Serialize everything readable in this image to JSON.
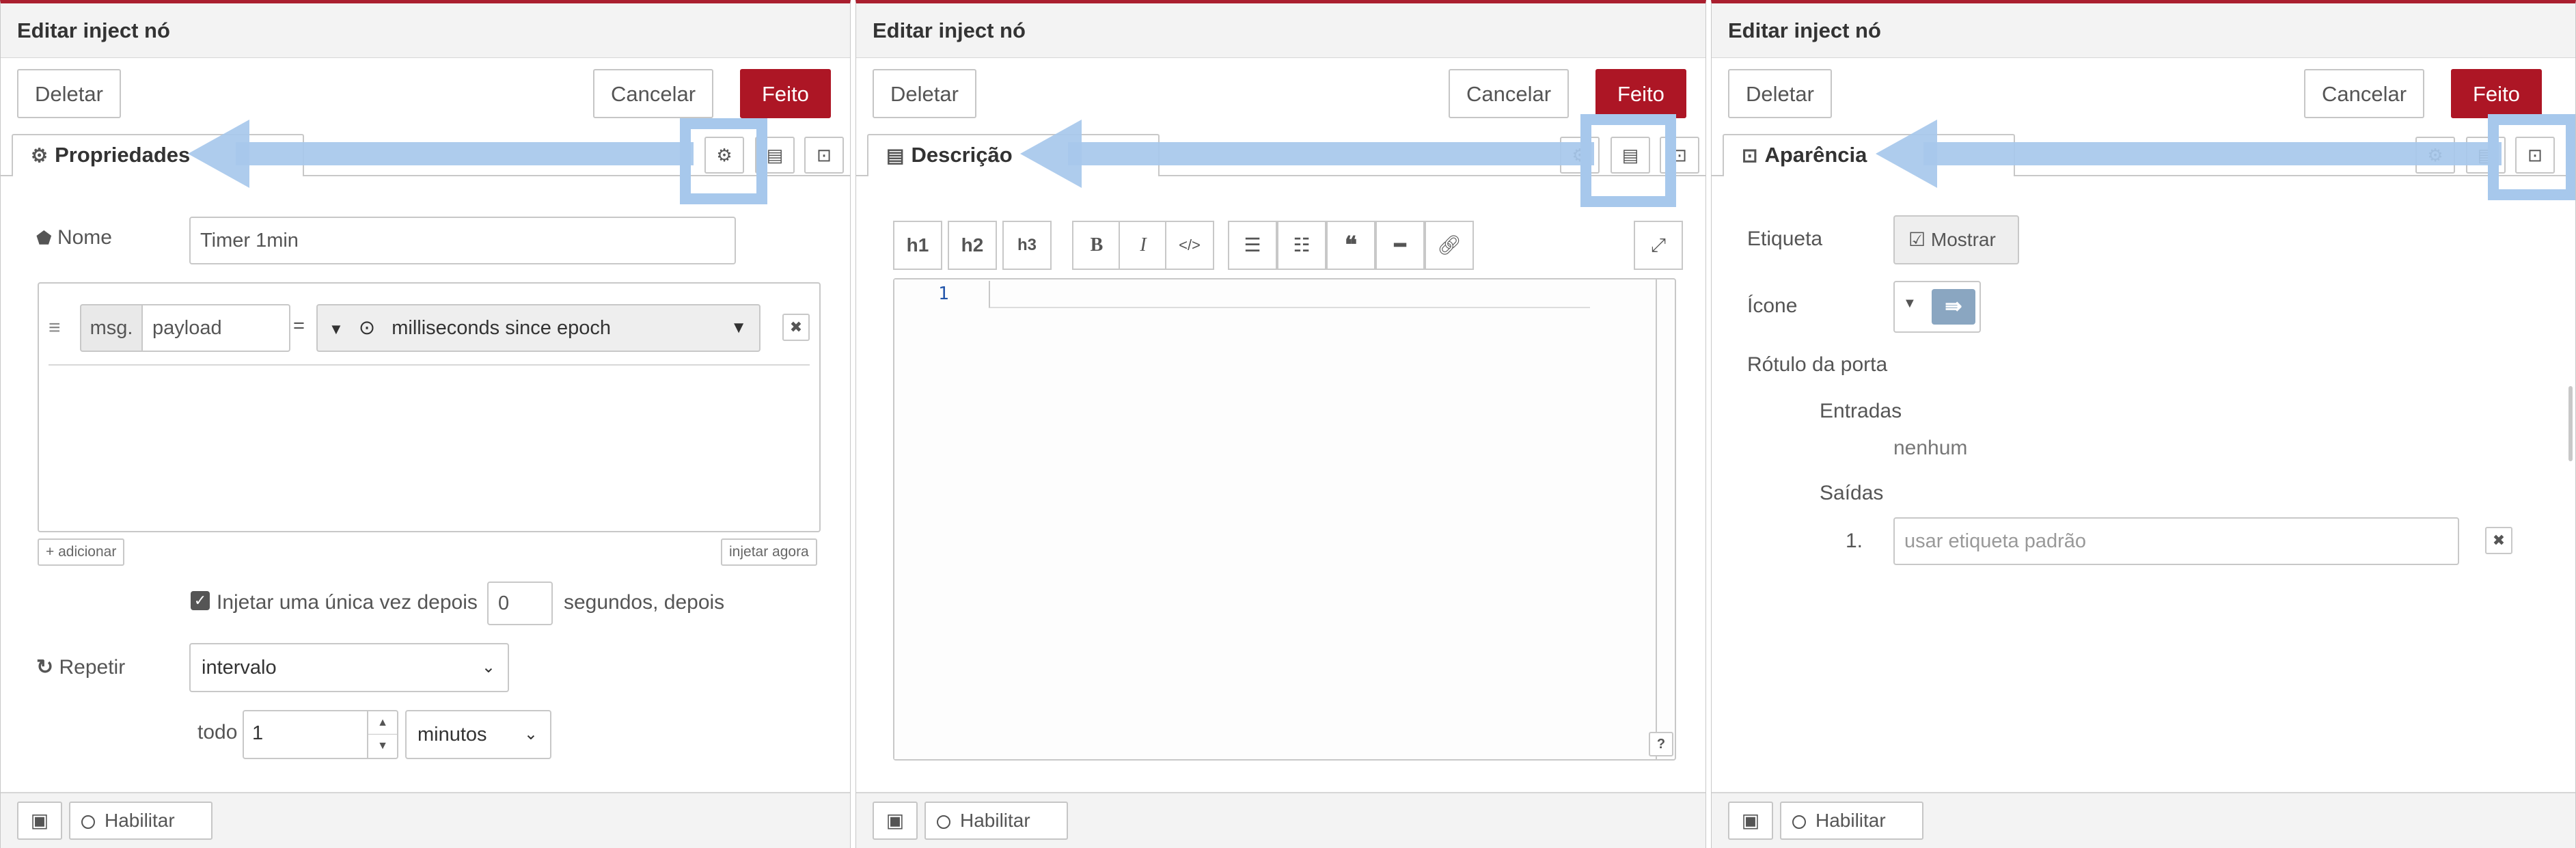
{
  "panels": [
    {
      "title": "Editar inject nó",
      "delete_label": "Deletar",
      "cancel_label": "Cancelar",
      "done_label": "Feito",
      "tab_label": "Propriedades",
      "name_label": "Nome",
      "name_value": "Timer 1min",
      "msg_prefix": "msg.",
      "prop_value": "payload",
      "equals": "=",
      "type_value": "milliseconds since epoch",
      "add_label": "adicionar",
      "inject_now_label": "injetar agora",
      "once_label": "Injetar uma única vez depois",
      "once_value": "0",
      "seconds_label": "segundos, depois",
      "repeat_label": "Repetir",
      "repeat_value": "intervalo",
      "every_label": "todo",
      "every_value": "1",
      "unit_value": "minutos",
      "enable_label": "Habilitar"
    },
    {
      "title": "Editar inject nó",
      "delete_label": "Deletar",
      "cancel_label": "Cancelar",
      "done_label": "Feito",
      "tab_label": "Descrição",
      "toolbar": [
        "h1",
        "h2",
        "h3",
        "B",
        "I"
      ],
      "line_number": "1",
      "help": "?",
      "enable_label": "Habilitar"
    },
    {
      "title": "Editar inject nó",
      "delete_label": "Deletar",
      "cancel_label": "Cancelar",
      "done_label": "Feito",
      "tab_label": "Aparência",
      "label_label": "Etiqueta",
      "show_label": "Mostrar",
      "icon_label": "Ícone",
      "port_label": "Rótulo da porta",
      "inputs_label": "Entradas",
      "inputs_value": "nenhum",
      "outputs_label": "Saídas",
      "output_num": "1.",
      "output_placeholder": "usar etiqueta padrão",
      "enable_label": "Habilitar"
    }
  ],
  "colors": {
    "primary": "#ad1625",
    "highlight": "#a7c8ec",
    "border": "#c8c8c8"
  }
}
